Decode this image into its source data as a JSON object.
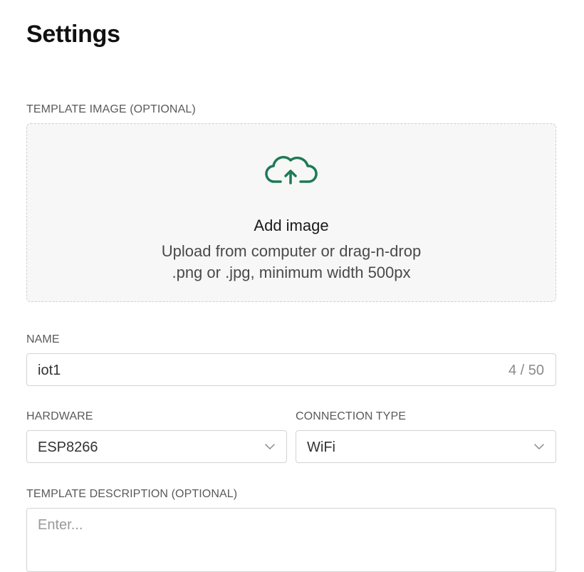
{
  "page": {
    "title": "Settings"
  },
  "template_image": {
    "label": "TEMPLATE IMAGE (OPTIONAL)",
    "icon": "cloud-upload-icon",
    "title": "Add image",
    "line1": "Upload from computer or drag-n-drop",
    "line2": ".png or .jpg, minimum width 500px",
    "icon_color": "#1e7a55"
  },
  "name": {
    "label": "NAME",
    "value": "iot1",
    "counter": "4 / 50"
  },
  "hardware": {
    "label": "HARDWARE",
    "value": "ESP8266",
    "icon": "chevron-down-icon"
  },
  "connection": {
    "label": "CONNECTION TYPE",
    "value": "WiFi",
    "icon": "chevron-down-icon"
  },
  "description": {
    "label": "TEMPLATE DESCRIPTION (OPTIONAL)",
    "placeholder": "Enter..."
  }
}
